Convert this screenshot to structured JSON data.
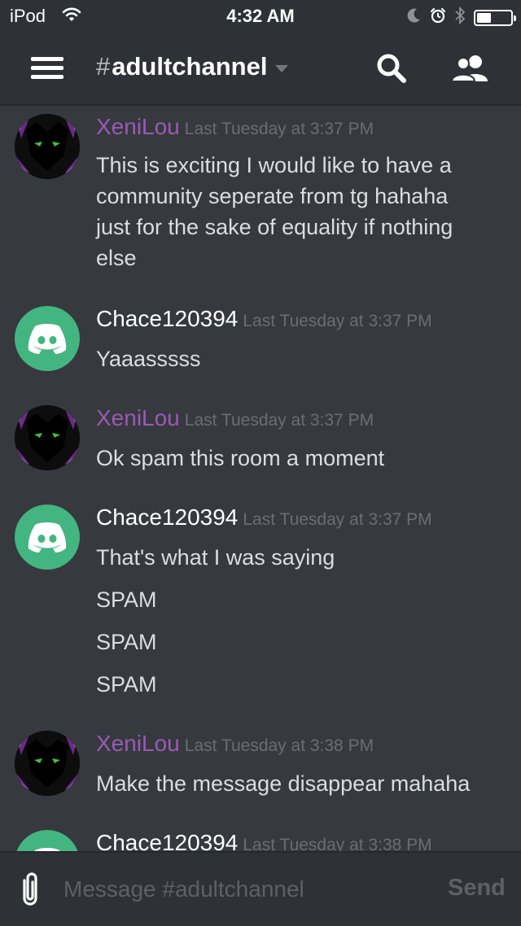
{
  "status_bar": {
    "carrier": "iPod",
    "time": "4:32 AM",
    "battery_level": 0.42
  },
  "header": {
    "channel_prefix": "#",
    "channel_name": "adultchannel"
  },
  "messages": [
    {
      "author": "XeniLou",
      "author_color": "#9b59b6",
      "timestamp": "Last Tuesday at 3:37 PM",
      "avatar": "wolf-avatar",
      "lines": [
        "This is exciting I would like to have a",
        "community seperate from tg hahaha",
        "just for the sake of equality if nothing",
        "else"
      ]
    },
    {
      "author": "Chace120394",
      "author_color": "#ffffff",
      "timestamp": "Last Tuesday at 3:37 PM",
      "avatar": "discord-default-avatar",
      "lines": [
        "Yaaasssss"
      ]
    },
    {
      "author": "XeniLou",
      "author_color": "#9b59b6",
      "timestamp": "Last Tuesday at 3:37 PM",
      "avatar": "wolf-avatar",
      "lines": [
        "Ok spam this room a moment"
      ]
    },
    {
      "author": "Chace120394",
      "author_color": "#ffffff",
      "timestamp": "Last Tuesday at 3:37 PM",
      "avatar": "discord-default-avatar",
      "lines": [
        "That's what I was saying",
        "SPAM",
        "SPAM",
        "SPAM"
      ]
    },
    {
      "author": "XeniLou",
      "author_color": "#9b59b6",
      "timestamp": "Last Tuesday at 3:38 PM",
      "avatar": "wolf-avatar",
      "lines": [
        "Make the message disappear mahaha"
      ]
    },
    {
      "author": "Chace120394",
      "author_color": "#ffffff",
      "timestamp": "Last Tuesday at 3:38 PM",
      "avatar": "discord-default-avatar",
      "lines": []
    }
  ],
  "composer": {
    "placeholder": "Message #adultchannel",
    "send_label": "Send"
  },
  "colors": {
    "background": "#36393e",
    "bar": "#2e3136",
    "discord_green": "#43b581",
    "xeni_purple": "#9b59b6",
    "timestamp": "#6a6d72"
  },
  "icons": [
    "wifi-icon",
    "moon-icon",
    "alarm-icon",
    "bluetooth-icon",
    "battery-icon",
    "hamburger-menu-icon",
    "chevron-down-icon",
    "search-icon",
    "members-icon",
    "paperclip-icon"
  ]
}
